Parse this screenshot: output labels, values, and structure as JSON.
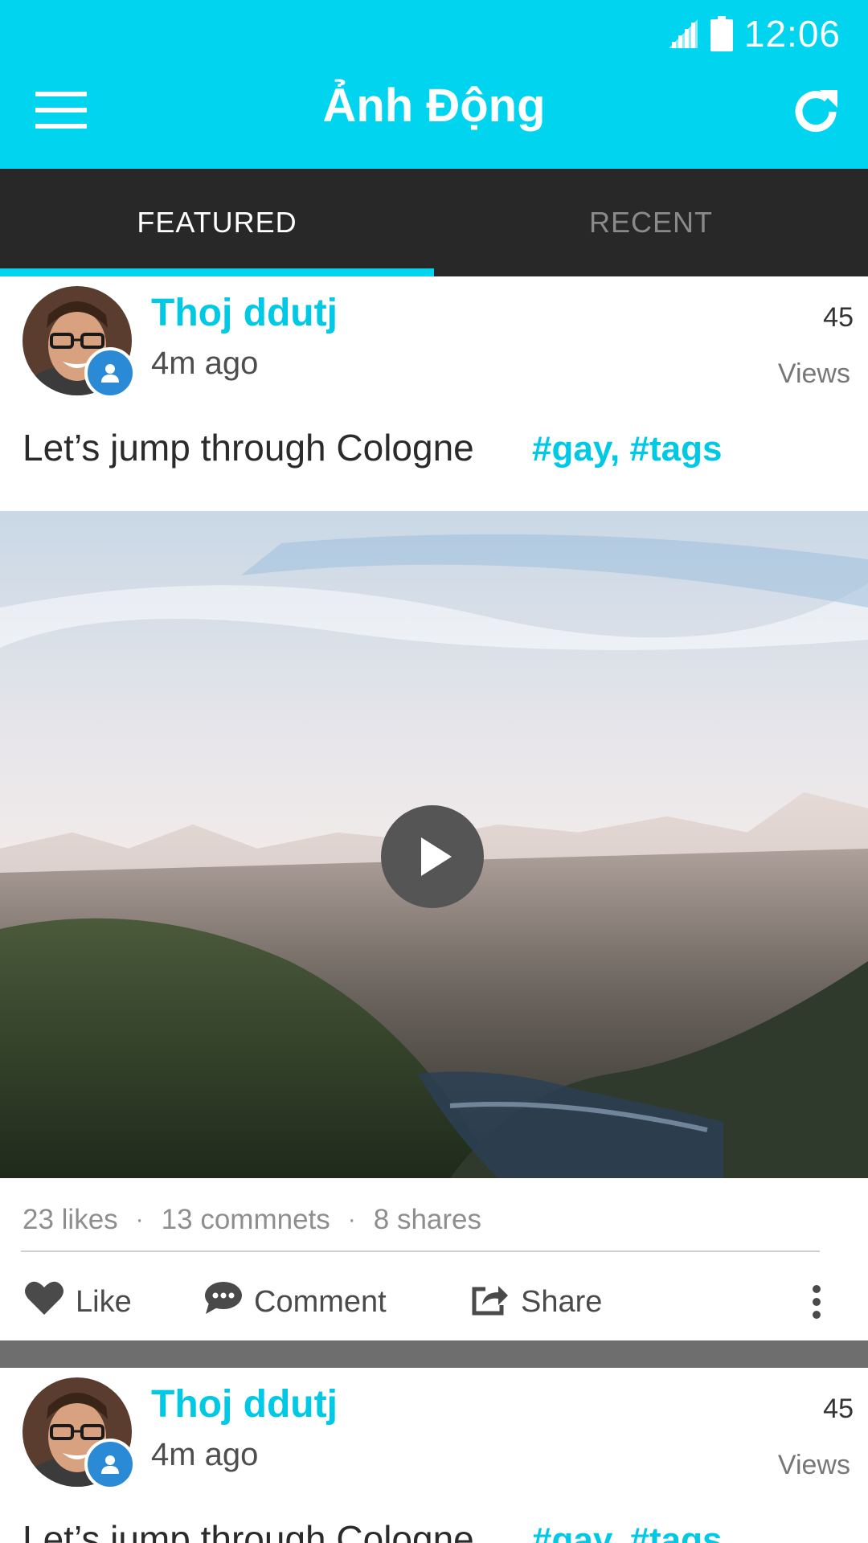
{
  "status_bar": {
    "time": "12:06"
  },
  "toolbar": {
    "title": "Ảnh Động",
    "menu_icon": "menu-icon",
    "refresh_icon": "refresh-icon"
  },
  "tabs": [
    {
      "label": "FEATURED",
      "active": true
    },
    {
      "label": "RECENT",
      "active": false
    }
  ],
  "colors": {
    "accent": "#00d4ef",
    "tab_bar": "#282828",
    "badge": "#2a8ad6",
    "divider_band": "#6e6e6e"
  },
  "posts": [
    {
      "author": "Thoj ddutj",
      "time_ago": "4m ago",
      "views_count": "45",
      "views_label": "Views",
      "caption": "Let’s jump through Cologne",
      "tags": "#gay, #tags",
      "stats": {
        "likes": "23 likes",
        "comments": "13 commnets",
        "shares": "8 shares"
      },
      "actions": {
        "like": "Like",
        "comment": "Comment",
        "share": "Share"
      }
    },
    {
      "author": "Thoj ddutj",
      "time_ago": "4m ago",
      "views_count": "45",
      "views_label": "Views",
      "caption": "Let’s jump through Cologne",
      "tags": "#gay, #tags"
    }
  ]
}
